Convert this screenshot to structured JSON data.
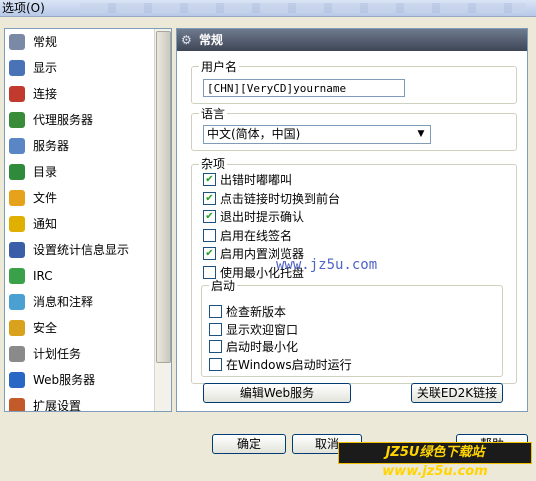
{
  "window": {
    "title": "选项(O)"
  },
  "sidebar": {
    "items": [
      {
        "label": "常规",
        "icon": "gear-icon",
        "color": "#7a8aa6"
      },
      {
        "label": "显示",
        "icon": "monitor-icon",
        "color": "#4a73b7"
      },
      {
        "label": "连接",
        "icon": "plug-icon",
        "color": "#c23a2e"
      },
      {
        "label": "代理服务器",
        "icon": "proxy-icon",
        "color": "#3a8c3a"
      },
      {
        "label": "服务器",
        "icon": "server-icon",
        "color": "#5a86c5"
      },
      {
        "label": "目录",
        "icon": "folder-icon",
        "color": "#2f8a3c"
      },
      {
        "label": "文件",
        "icon": "file-icon",
        "color": "#e6a21a"
      },
      {
        "label": "通知",
        "icon": "notify-icon",
        "color": "#e0b000"
      },
      {
        "label": "设置统计信息显示",
        "icon": "stats-icon",
        "color": "#3a5fa8"
      },
      {
        "label": "IRC",
        "icon": "irc-icon",
        "color": "#3aa04a"
      },
      {
        "label": "消息和注释",
        "icon": "message-icon",
        "color": "#4aa0d0"
      },
      {
        "label": "安全",
        "icon": "lock-icon",
        "color": "#d9a21c"
      },
      {
        "label": "计划任务",
        "icon": "schedule-icon",
        "color": "#8a8a8a"
      },
      {
        "label": "Web服务器",
        "icon": "web-icon",
        "color": "#2a66c4"
      },
      {
        "label": "扩展设置",
        "icon": "extend-icon",
        "color": "#c25a2a"
      }
    ]
  },
  "panel": {
    "title": "常规",
    "username": {
      "legend": "用户名",
      "value": "[CHN][VeryCD]yourname"
    },
    "language": {
      "legend": "语言",
      "value": "中文(简体，中国)"
    },
    "misc": {
      "legend": "杂项",
      "options": [
        {
          "label": "出错时嘟嘟叫",
          "checked": true
        },
        {
          "label": "点击链接时切换到前台",
          "checked": true
        },
        {
          "label": "退出时提示确认",
          "checked": true
        },
        {
          "label": "启用在线签名",
          "checked": false
        },
        {
          "label": "启用内置浏览器",
          "checked": true
        },
        {
          "label": "使用最小化托盘",
          "checked": false
        }
      ]
    },
    "startup": {
      "legend": "启动",
      "options": [
        {
          "label": "检查新版本",
          "checked": false
        },
        {
          "label": "显示欢迎窗口",
          "checked": false
        },
        {
          "label": "启动时最小化",
          "checked": false
        },
        {
          "label": "在Windows启动时运行",
          "checked": false
        }
      ]
    },
    "edit_web_button": "编辑Web服务",
    "ed2k_button": "关联ED2K链接"
  },
  "watermark": "www.jz5u.com",
  "buttons": {
    "ok": "确定",
    "cancel": "取消",
    "help": "帮助"
  },
  "brand": "JZ5U绿色下载站 www.jz5u.com"
}
